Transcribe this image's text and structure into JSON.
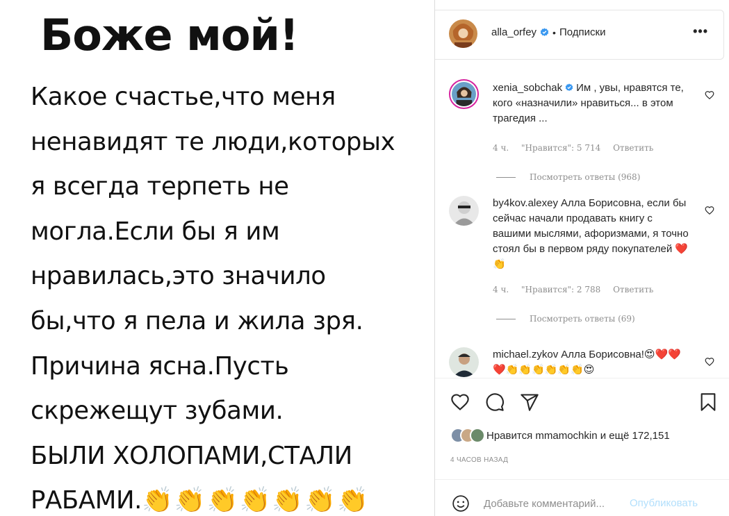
{
  "post": {
    "headline": "Боже мой!",
    "lines": [
      "Какое счастье,что меня",
      "ненавидят те люди,которых",
      "я всегда терпеть не",
      "могла.Если бы я им",
      "нравилась,это значило",
      "бы,что я пела и жила зря.",
      "Причина ясна.Пусть",
      "скрежещут зубами.",
      "БЫЛИ ХОЛОПАМИ,СТАЛИ"
    ],
    "last_line": "РАБАМИ.",
    "claps": "👏👏👏👏👏👏👏"
  },
  "header": {
    "username": "alla_orfey",
    "dot": "•",
    "follow": "Подписки",
    "more": "•••"
  },
  "comments": [
    {
      "username": "xenia_sobchak",
      "verified": true,
      "text": "Им , увы, нравятся те, кого «назначили» нравиться... в этом трагедия ...",
      "time": "4 ч.",
      "likes": "\"Нравится\": 5 714",
      "reply": "Ответить",
      "view_replies": "Посмотреть ответы (968)"
    },
    {
      "username": "by4kov.alexey",
      "verified": false,
      "text": "Алла Борисовна, если бы сейчас начали продавать книгу с вашими мыслями, афоризмами, я точно стоял бы в первом ряду покупателей ❤️👏",
      "time": "4 ч.",
      "likes": "\"Нравится\": 2 788",
      "reply": "Ответить",
      "view_replies": "Посмотреть ответы (69)"
    },
    {
      "username": "michael.zykov",
      "verified": false,
      "text": "Алла Борисовна!😍❤️❤️❤️👏👏👏👏👏👏😍"
    }
  ],
  "likes": {
    "prefix": "Нравится",
    "user": "mmamochkin",
    "middle": "и",
    "rest": "ещё 172,151"
  },
  "timestamp": "4 ЧАСОВ НАЗАД",
  "comment_box": {
    "placeholder": "Добавьте комментарий...",
    "publish": "Опубликовать"
  },
  "colors": {
    "verified": "#3897f0",
    "publish_disabled": "#b2dffc",
    "heart_red": "#e0245e"
  }
}
